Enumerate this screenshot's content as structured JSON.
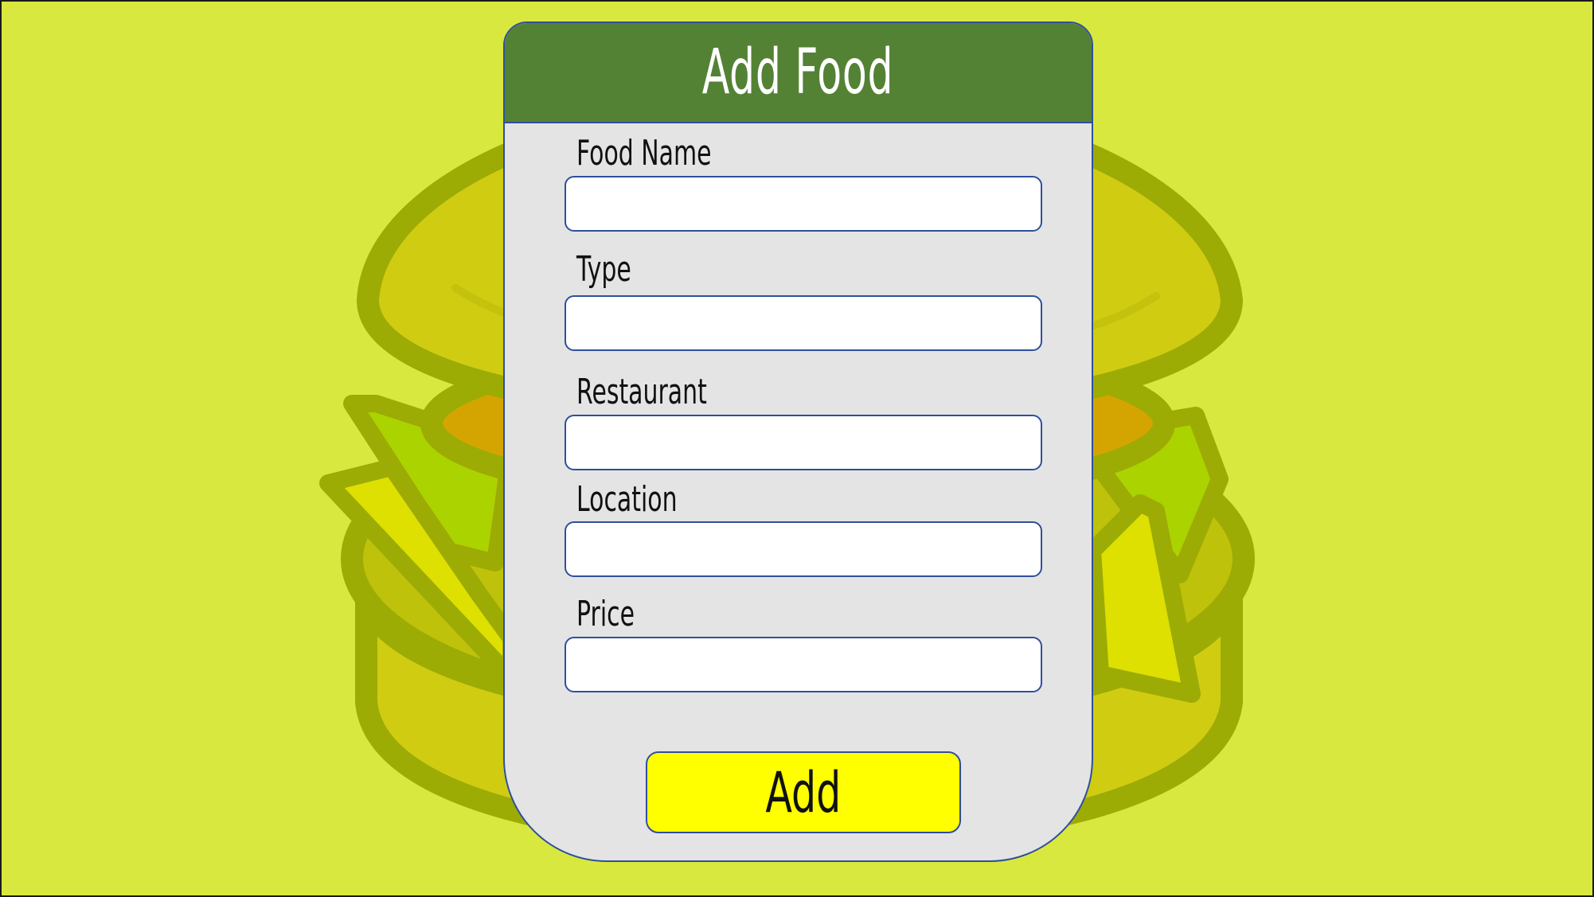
{
  "window": {
    "background_color": "#d9e83f"
  },
  "background_art": {
    "icon": "burger-icon"
  },
  "dialog": {
    "title": "Add Food",
    "header_color": "#548235",
    "panel_color": "#e4e4e4",
    "border_color": "#2f4f9c"
  },
  "form": {
    "fields": [
      {
        "label": "Food Name",
        "value": "",
        "placeholder": ""
      },
      {
        "label": "Type",
        "value": "",
        "placeholder": ""
      },
      {
        "label": "Restaurant",
        "value": "",
        "placeholder": ""
      },
      {
        "label": "Location",
        "value": "",
        "placeholder": ""
      },
      {
        "label": "Price",
        "value": "",
        "placeholder": ""
      }
    ],
    "submit_label": "Add",
    "submit_color": "#ffff00"
  }
}
